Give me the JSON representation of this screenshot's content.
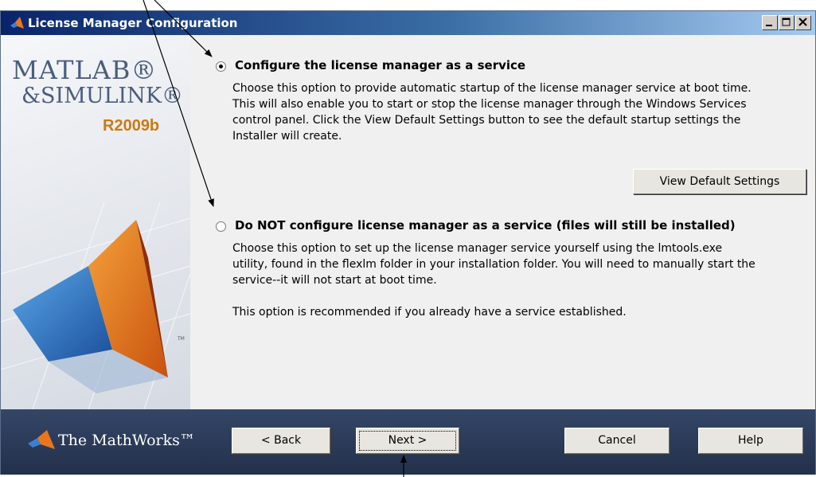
{
  "window": {
    "title": "License Manager Configuration"
  },
  "sidebar": {
    "logo_line1": "MATLAB®",
    "logo_line2": "&SIMULINK®",
    "release": "R2009b"
  },
  "options": [
    {
      "title": "Configure the license manager as a service",
      "selected": true,
      "description": [
        "Choose this option to provide automatic startup of the license manager service at boot time.",
        "This will also enable you to start or stop the license manager through the Windows Services",
        "control panel.  Click the View Default Settings button to see the default startup settings the",
        "Installer will create."
      ],
      "button_label": "View Default Settings"
    },
    {
      "title": "Do NOT configure license manager as a service (files will still be installed)",
      "selected": false,
      "description": [
        "Choose this option to set up the license manager service yourself using the lmtools.exe",
        "utility, found in the flexlm folder in your installation folder.  You will need to manually start the",
        "service--it will not start at boot time."
      ],
      "note": "This option is recommended if you already have a service established."
    }
  ],
  "footer": {
    "brand": "The MathWorks™",
    "back_label": "< Back",
    "next_label": "Next >",
    "cancel_label": "Cancel",
    "help_label": "Help"
  },
  "icons": {
    "title_icon": "matlab-membrane-icon",
    "minimize": "minimize-icon",
    "maximize": "maximize-icon",
    "close": "close-icon",
    "brand_icon": "mathworks-logo-icon"
  },
  "colors": {
    "titlebar": "#0a246a",
    "footer": "#2b3a58",
    "release_accent": "#c97b12",
    "logo_text": "#4a5d7e"
  }
}
